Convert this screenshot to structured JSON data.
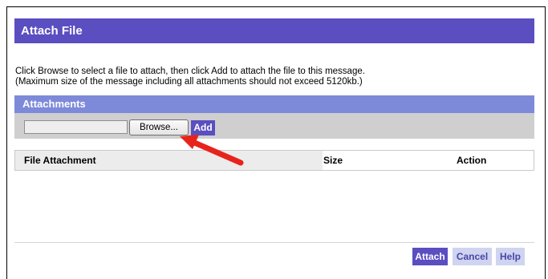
{
  "dialog": {
    "title": "Attach File",
    "instructions_line1": "Click Browse to select a file to attach, then click Add to attach the file to this message.",
    "instructions_line2": "(Maximum size of the message including all attachments should not exceed 5120kb.)"
  },
  "attachments": {
    "section_title": "Attachments",
    "file_input_value": "",
    "browse_label": "Browse...",
    "add_label": "Add",
    "columns": [
      "File Attachment",
      "Size",
      "Action"
    ],
    "rows": []
  },
  "footer": {
    "attach_label": "Attach",
    "cancel_label": "Cancel",
    "help_label": "Help"
  },
  "annotation": {
    "icon": "red-arrow-icon",
    "color": "#e8231c"
  },
  "colors": {
    "title_bar": "#5a4ec1",
    "section_header": "#7d89d9",
    "upload_row": "#cfcfcf"
  }
}
